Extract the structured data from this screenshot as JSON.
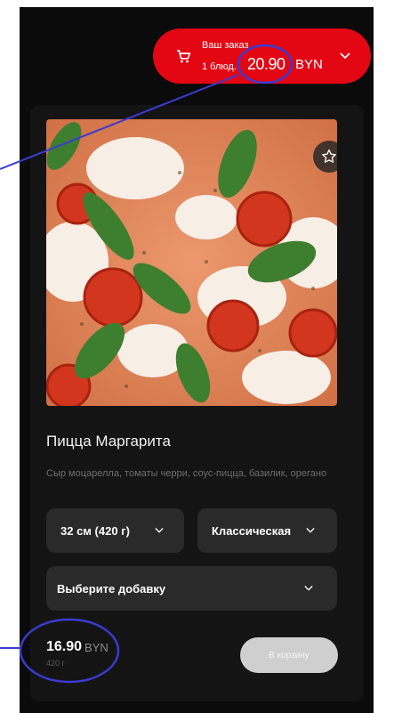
{
  "order": {
    "title": "Ваш заказ",
    "quantity": "1 блюд.",
    "total": "20.90",
    "currency": "BYN"
  },
  "product": {
    "name": "Пицца Маргарита",
    "description": "Сыр моцарелла, томаты черри, соус-пицца, базилик, орегано",
    "size_option": "32 см (420 г)",
    "dough_option": "Классическая",
    "addon_placeholder": "Выберите добавку",
    "price": "16.90",
    "currency": "BYN",
    "weight": "420 г",
    "cart_button_label": "В корзину"
  },
  "colors": {
    "accent": "#e30613",
    "background": "#0b0b0b",
    "card": "#141414",
    "select": "#2a2a2a",
    "annotation": "#3b3bd1"
  }
}
